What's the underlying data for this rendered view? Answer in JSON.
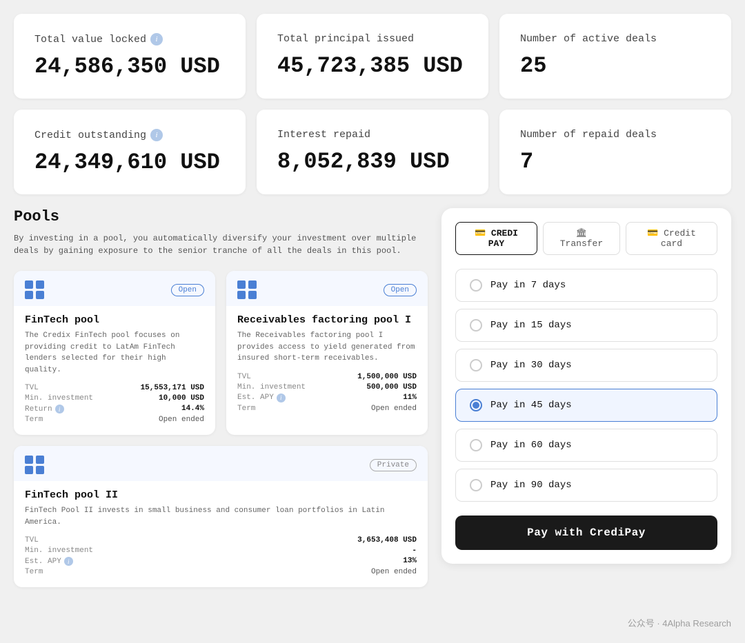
{
  "stats": [
    {
      "id": "total-value-locked",
      "label": "Total value locked",
      "value": "24,586,350 USD",
      "hasInfo": true
    },
    {
      "id": "total-principal-issued",
      "label": "Total principal issued",
      "value": "45,723,385 USD",
      "hasInfo": false
    },
    {
      "id": "number-of-active-deals",
      "label": "Number of active deals",
      "value": "25",
      "hasInfo": false
    },
    {
      "id": "credit-outstanding",
      "label": "Credit outstanding",
      "value": "24,349,610 USD",
      "hasInfo": true
    },
    {
      "id": "interest-repaid",
      "label": "Interest repaid",
      "value": "8,052,839 USD",
      "hasInfo": false
    },
    {
      "id": "number-of-repaid-deals",
      "label": "Number of repaid deals",
      "value": "7",
      "hasInfo": false
    }
  ],
  "pools": {
    "section_title": "Pools",
    "section_description": "By investing in a pool, you automatically diversify your investment over\nmultiple deals by gaining exposure to the senior tranche of all the deals in\nthis pool.",
    "items": [
      {
        "id": "fintech-pool",
        "name": "FinTech pool",
        "badge": "Open",
        "badge_type": "open",
        "description": "The Credix FinTech pool focuses on providing credit to LatAm FinTech lenders selected for their high quality.",
        "stats": [
          {
            "key": "TVL",
            "value": "15,553,171 USD",
            "info": false
          },
          {
            "key": "Min. investment",
            "value": "10,000 USD",
            "info": false
          },
          {
            "key": "Return",
            "value": "14.4%",
            "info": true
          },
          {
            "key": "Term",
            "value": "Open ended",
            "value_class": "open-ended"
          }
        ]
      },
      {
        "id": "receivables-factoring-pool-i",
        "name": "Receivables factoring pool I",
        "badge": "Open",
        "badge_type": "open",
        "description": "The Receivables factoring pool I provides access to yield generated from insured short-term receivables.",
        "stats": [
          {
            "key": "TVL",
            "value": "1,500,000 USD",
            "info": false
          },
          {
            "key": "Min. investment",
            "value": "500,000 USD",
            "info": false
          },
          {
            "key": "Est. APY",
            "value": "11%",
            "info": true
          },
          {
            "key": "Term",
            "value": "Open ended",
            "value_class": "open-ended"
          }
        ]
      },
      {
        "id": "fintech-pool-ii",
        "name": "FinTech pool II",
        "badge": "Private",
        "badge_type": "private",
        "description": "FinTech Pool II invests in small business and consumer loan portfolios in Latin America.",
        "stats": [
          {
            "key": "TVL",
            "value": "3,653,408 USD",
            "info": false
          },
          {
            "key": "Min. investment",
            "value": "-",
            "info": false
          },
          {
            "key": "Est. APY",
            "value": "13%",
            "info": true
          },
          {
            "key": "Term",
            "value": "Open ended",
            "value_class": "open-ended"
          }
        ]
      }
    ]
  },
  "payment": {
    "tabs": [
      {
        "id": "credi-pay",
        "label": "CREDI PAY",
        "icon": "💳",
        "active": true
      },
      {
        "id": "transfer",
        "label": "Transfer",
        "icon": "🏛",
        "active": false
      },
      {
        "id": "credit-card",
        "label": "Credit card",
        "icon": "💳",
        "active": false
      }
    ],
    "options": [
      {
        "id": "7-days",
        "label": "Pay in 7 days",
        "selected": false
      },
      {
        "id": "15-days",
        "label": "Pay in 15 days",
        "selected": false
      },
      {
        "id": "30-days",
        "label": "Pay in 30 days",
        "selected": false
      },
      {
        "id": "45-days",
        "label": "Pay in 45 days",
        "selected": true
      },
      {
        "id": "60-days",
        "label": "Pay in 60 days",
        "selected": false
      },
      {
        "id": "90-days",
        "label": "Pay in 90 days",
        "selected": false
      }
    ],
    "pay_button_label": "Pay with CrediPay"
  },
  "watermark": "公众号 · 4Alpha Research"
}
